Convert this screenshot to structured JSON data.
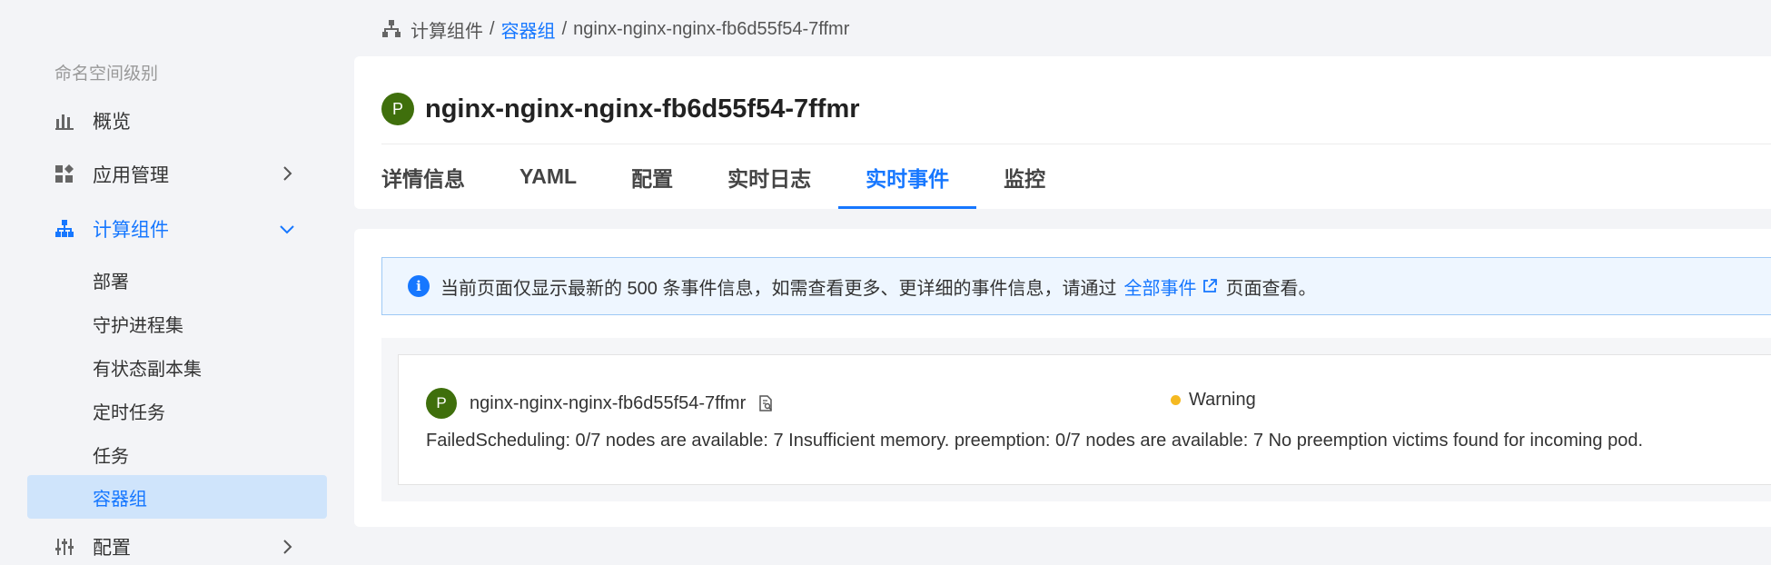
{
  "sidebar": {
    "section_label": "命名空间级别",
    "items": [
      {
        "label": "概览",
        "icon": "bar-chart-icon"
      },
      {
        "label": "应用管理",
        "icon": "apps-icon"
      },
      {
        "label": "计算组件",
        "icon": "sitemap-icon"
      },
      {
        "label": "配置",
        "icon": "sliders-icon"
      }
    ],
    "sub_items": [
      {
        "label": "部署"
      },
      {
        "label": "守护进程集"
      },
      {
        "label": "有状态副本集"
      },
      {
        "label": "定时任务"
      },
      {
        "label": "任务"
      },
      {
        "label": "容器组"
      }
    ]
  },
  "breadcrumb": {
    "root": "计算组件",
    "parent": "容器组",
    "current": "nginx-nginx-nginx-fb6d55f54-7ffmr",
    "separator": "/"
  },
  "header": {
    "badge": "P",
    "title": "nginx-nginx-nginx-fb6d55f54-7ffmr",
    "tabs": [
      {
        "label": "详情信息"
      },
      {
        "label": "YAML"
      },
      {
        "label": "配置"
      },
      {
        "label": "实时日志"
      },
      {
        "label": "实时事件"
      },
      {
        "label": "监控"
      }
    ],
    "active_tab": "实时事件"
  },
  "banner": {
    "icon": "i",
    "text": "当前页面仅显示最新的 500 条事件信息，如需查看更多、更详细的事件信息，请通过",
    "link": "全部事件",
    "tail": "页面查看。"
  },
  "event": {
    "badge": "P",
    "pod_name": "nginx-nginx-nginx-fb6d55f54-7ffmr",
    "status": "Warning",
    "status_color": "#f5b921",
    "message": "FailedScheduling: 0/7 nodes are available: 7 Insufficient memory. preemption: 0/7 nodes are available: 7 No preemption victims found for incoming pod."
  },
  "colors": {
    "accent": "#1677ff",
    "badge": "#3f6f0c",
    "selected_bg": "#cfe4fb"
  }
}
